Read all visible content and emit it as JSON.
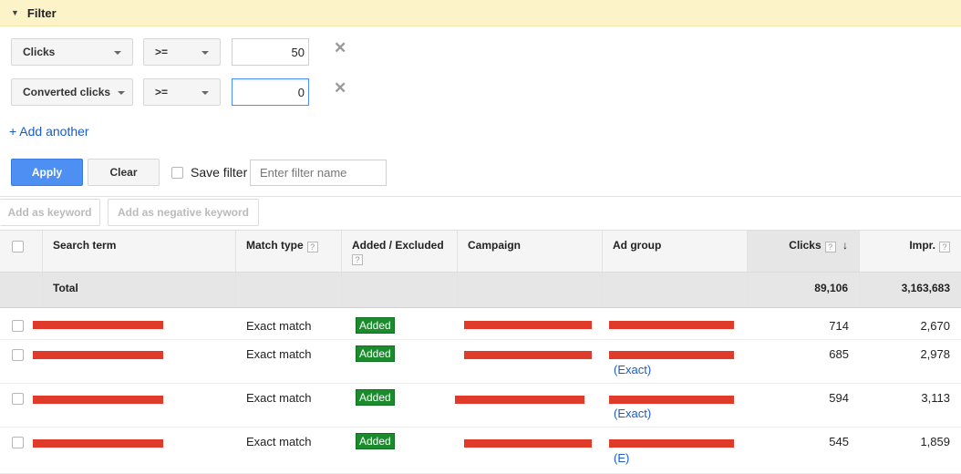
{
  "filter": {
    "title": "Filter",
    "rows": [
      {
        "metric": "Clicks",
        "operator": ">=",
        "value": "50"
      },
      {
        "metric": "Converted clicks",
        "operator": ">=",
        "value": "0"
      }
    ],
    "add_another": "+ Add another",
    "apply_label": "Apply",
    "clear_label": "Clear",
    "save_filter_label": "Save filter",
    "filter_name_placeholder": "Enter filter name"
  },
  "actions": {
    "add_keyword": "Add as keyword",
    "add_negative": "Add as negative keyword"
  },
  "table": {
    "headers": {
      "search_term": "Search term",
      "match_type": "Match type",
      "added_excluded": "Added / Excluded",
      "campaign": "Campaign",
      "ad_group": "Ad group",
      "clicks": "Clicks",
      "impr": "Impr.",
      "help": "?",
      "sort_arrow": "↓"
    },
    "total": {
      "label": "Total",
      "clicks": "89,106",
      "impr": "3,163,683"
    },
    "rows": [
      {
        "match_type": "Exact match",
        "status": "Added",
        "ad_group_sub": "",
        "clicks": "714",
        "impr": "2,670"
      },
      {
        "match_type": "Exact match",
        "status": "Added",
        "ad_group_sub": "(Exact)",
        "clicks": "685",
        "impr": "2,978"
      },
      {
        "match_type": "Exact match",
        "status": "Added",
        "ad_group_sub": "(Exact)",
        "clicks": "594",
        "impr": "3,113"
      },
      {
        "match_type": "Exact match",
        "status": "Added",
        "ad_group_sub": "(E)",
        "clicks": "545",
        "impr": "1,859"
      }
    ]
  },
  "colors": {
    "filter_bar": "#fdf3c8",
    "apply_button": "#4d8ff3",
    "added_badge": "#1b8b2d",
    "redaction": "#e03a2b",
    "link": "#1a5bc4"
  }
}
